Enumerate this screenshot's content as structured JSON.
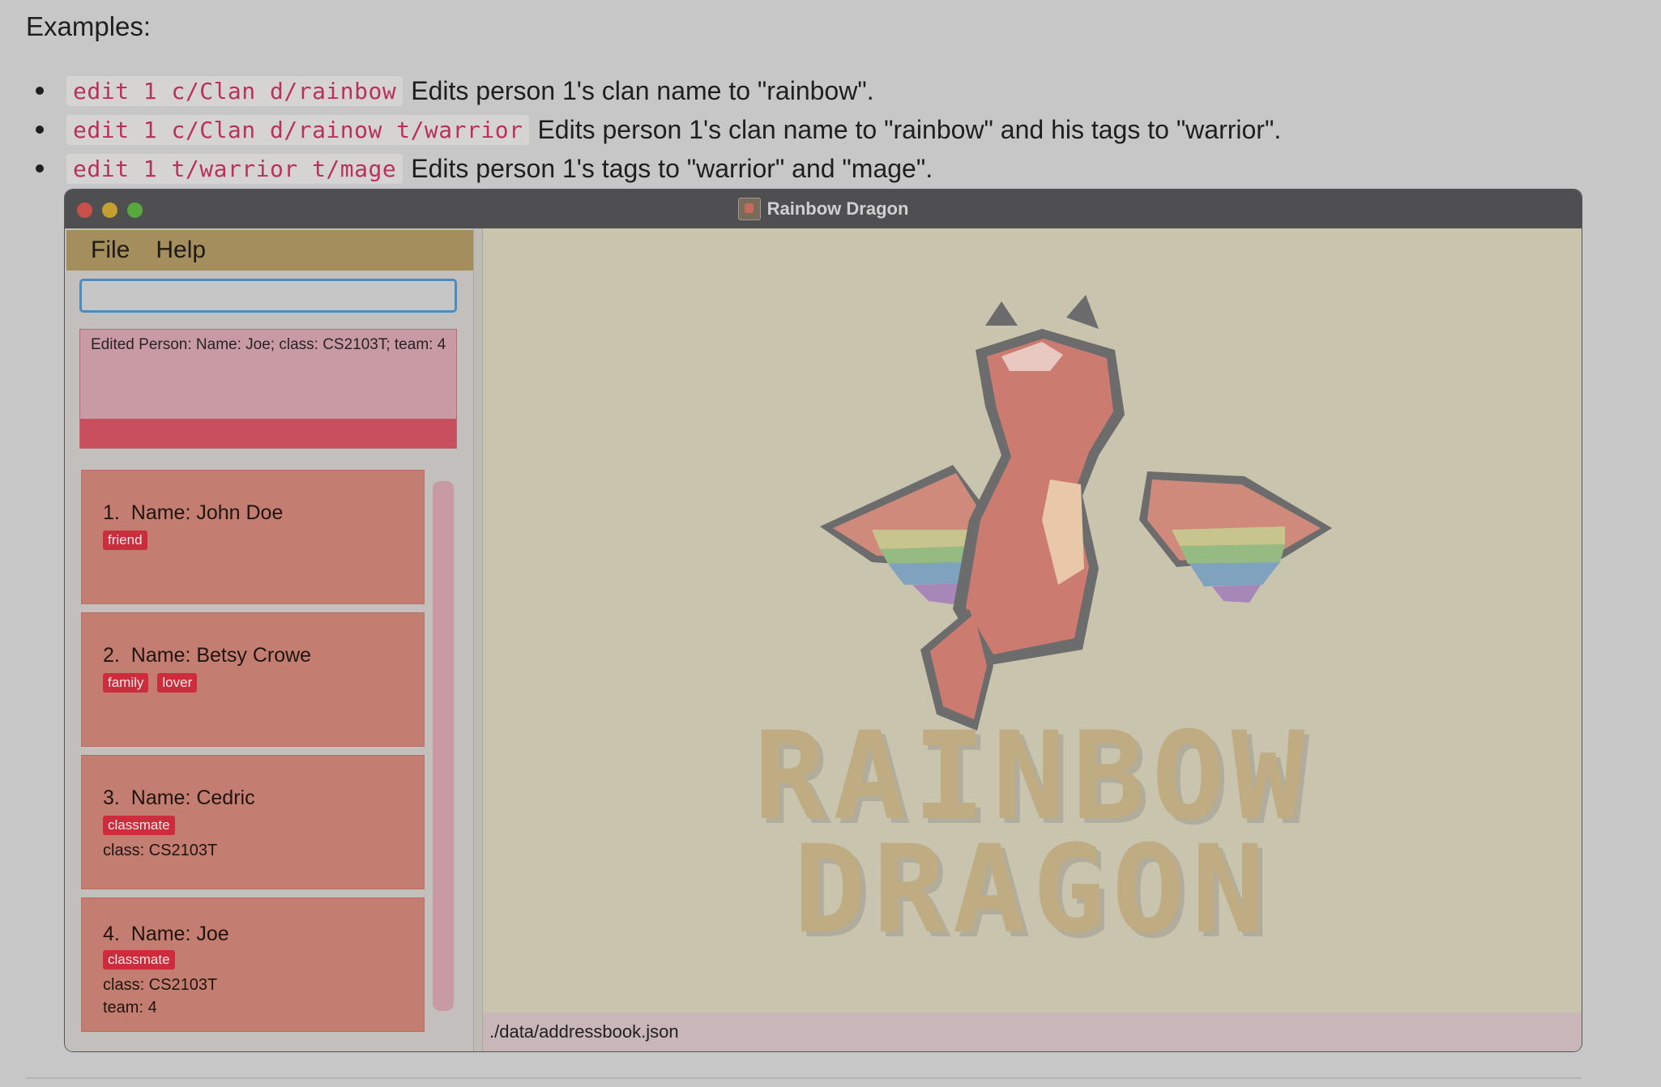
{
  "doc": {
    "heading": "Examples:",
    "examples": [
      {
        "code": "edit 1 c/Clan d/rainbow",
        "desc": "Edits person 1's clan name to \"rainbow\"."
      },
      {
        "code": "edit 1 c/Clan d/rainow t/warrior",
        "desc": "Edits person 1's clan name to \"rainbow\" and his tags to \"warrior\"."
      },
      {
        "code": "edit 1 t/warrior t/mage",
        "desc": "Edits person 1's tags to \"warrior\" and \"mage\"."
      }
    ]
  },
  "window": {
    "title": "Rainbow Dragon",
    "menu": {
      "file": "File",
      "help": "Help"
    },
    "command_input": {
      "value": "",
      "placeholder": ""
    },
    "result_text": "Edited Person: Name: Joe; class: CS2103T; team: 4",
    "persons": [
      {
        "index": "1.",
        "name": "Name: John Doe",
        "tags": [
          "friend"
        ]
      },
      {
        "index": "2.",
        "name": "Name: Betsy Crowe",
        "tags": [
          "family",
          "lover"
        ]
      },
      {
        "index": "3.",
        "name": "Name: Cedric",
        "tags": [
          "classmate"
        ],
        "class": "class: CS2103T"
      },
      {
        "index": "4.",
        "name": "Name: Joe",
        "tags": [
          "classmate"
        ],
        "class": "class: CS2103T",
        "team": "team: 4"
      }
    ],
    "logo": {
      "line1": "RAINBOW",
      "line2": "DRAGON"
    },
    "status_path": "./data/addressbook.json"
  },
  "colors": {
    "menubar": "#a58e5e",
    "card": "#c47e71",
    "tag": "#cc2c3c",
    "result_bar": "#c94f5f",
    "logo_text": "#c0ac82"
  }
}
